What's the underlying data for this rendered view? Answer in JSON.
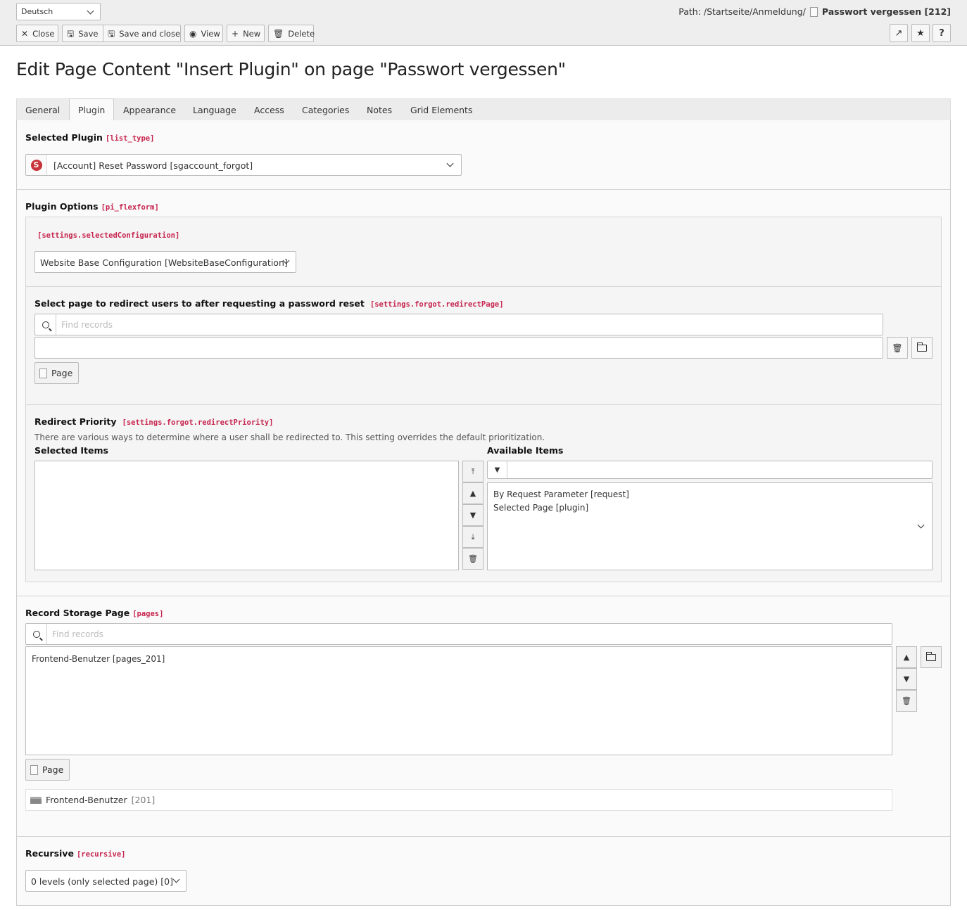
{
  "header": {
    "language": "Deutsch",
    "buttons": {
      "close": "Close",
      "save": "Save",
      "save_and_close": "Save and close",
      "view": "View",
      "new": "New",
      "delete": "Delete"
    },
    "path_prefix": "Path: /Startseite/Anmeldung/",
    "path_page": "Passwort vergessen [212]"
  },
  "page_title": "Edit Page Content \"Insert Plugin\" on page \"Passwort vergessen\"",
  "tabs": [
    "General",
    "Plugin",
    "Appearance",
    "Language",
    "Access",
    "Categories",
    "Notes",
    "Grid Elements"
  ],
  "active_tab": "Plugin",
  "selected_plugin": {
    "label": "Selected Plugin",
    "field": "[list_type]",
    "value": "[Account] Reset Password [sgaccount_forgot]",
    "icon_letter": "S"
  },
  "plugin_options": {
    "label": "Plugin Options",
    "field": "[pi_flexform]",
    "configuration": {
      "field": "[settings.selectedConfiguration]",
      "value": "Website Base Configuration [WebsiteBaseConfiguration]"
    },
    "redirect_page": {
      "label": "Select page to redirect users to after requesting a password reset",
      "field": "[settings.forgot.redirectPage]",
      "search_placeholder": "Find records",
      "page_button": "Page"
    },
    "redirect_priority": {
      "label": "Redirect Priority",
      "field": "[settings.forgot.redirectPriority]",
      "description": "There are various ways to determine where a user shall be redirected to. This setting overrides the default prioritization.",
      "selected_label": "Selected Items",
      "available_label": "Available Items",
      "available_items": [
        "By Request Parameter [request]",
        "Selected Page [plugin]"
      ]
    }
  },
  "record_storage": {
    "label": "Record Storage Page",
    "field": "[pages]",
    "search_placeholder": "Find records",
    "items": [
      "Frontend-Benutzer [pages_201]"
    ],
    "page_button": "Page",
    "breadcrumb_name": "Frontend-Benutzer",
    "breadcrumb_id": "[201]"
  },
  "recursive": {
    "label": "Recursive",
    "field": "[recursive]",
    "value": "0 levels (only selected page) [0]"
  }
}
